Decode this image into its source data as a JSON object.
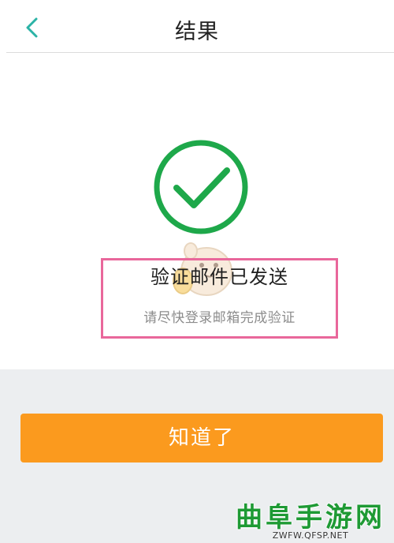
{
  "header": {
    "title": "结果",
    "back_icon": "chevron-left-icon",
    "accent_color": "#2bb3a6"
  },
  "result": {
    "status_icon": "check-circle-icon",
    "status_color": "#1ea84a",
    "title": "验证邮件已发送",
    "subtitle": "请尽快登录邮箱完成验证"
  },
  "actions": {
    "confirm_label": "知道了",
    "confirm_color": "#fb9a1e"
  },
  "annotation": {
    "highlight_color": "#e9679b"
  },
  "watermark": {
    "name": "曲阜手游网",
    "url": "ZWFW.QFSP.NET"
  }
}
